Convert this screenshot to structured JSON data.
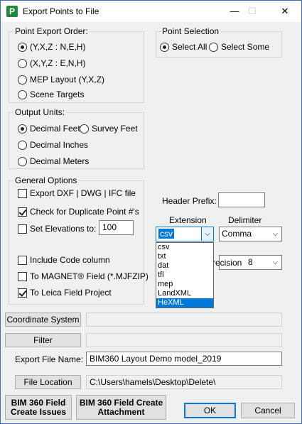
{
  "window": {
    "title": "Export Points to File",
    "icon_letter": "P",
    "minimize_glyph": "—",
    "maximize_glyph": "☐",
    "close_glyph": "✕"
  },
  "point_export_order": {
    "label": "Point Export Order:",
    "options": [
      "(Y,X,Z  :  N,E,H)",
      "(X,Y,Z  :  E,N,H)",
      "MEP Layout (Y,X,Z)",
      "Scene Targets"
    ],
    "selected_index": 0
  },
  "point_selection": {
    "label": "Point Selection",
    "options": [
      "Select All",
      "Select Some"
    ],
    "selected_index": 0
  },
  "output_units": {
    "label": "Output Units:",
    "options": [
      "Decimal Feet",
      "Survey Feet",
      "Decimal Inches",
      "Decimal Meters"
    ],
    "selected_index": 0
  },
  "general_options": {
    "label": "General Options",
    "export_dxf": {
      "label": "Export DXF | DWG | IFC file",
      "checked": false
    },
    "check_duplicates": {
      "label": "Check for Duplicate Point #'s",
      "checked": true
    },
    "set_elevations": {
      "label": "Set Elevations to:",
      "checked": false,
      "value": "100"
    },
    "include_code": {
      "label": "Include Code column",
      "checked": false
    },
    "to_magnet": {
      "label": "To MAGNET® Field (*.MJFZIP)",
      "checked": false
    },
    "to_leica": {
      "label": "To Leica Field Project",
      "checked": true
    }
  },
  "header_prefix": {
    "label": "Header Prefix:",
    "value": ""
  },
  "extension": {
    "label": "Extension",
    "value": "csv",
    "options": [
      "csv",
      "txt",
      "dat",
      "tfl",
      "mep",
      "LandXML",
      "HeXML"
    ],
    "highlighted_index": 6
  },
  "delimiter": {
    "label": "Delimiter",
    "value": "Comma"
  },
  "precision": {
    "label_visible": "recision",
    "value": "8"
  },
  "coordinate_system": {
    "button": "Coordinate System",
    "value": ""
  },
  "filter": {
    "button": "Filter",
    "value": ""
  },
  "export_file_name": {
    "label": "Export File Name:",
    "value": "BIM360 Layout Demo model_2019"
  },
  "file_location": {
    "button": "File Location",
    "value": "C:\\Users\\hamels\\Desktop\\Delete\\"
  },
  "bottom_buttons": {
    "create_issues_line1": "BIM 360 Field",
    "create_issues_line2": "Create Issues",
    "create_attachment_line1": "BIM 360 Field Create",
    "create_attachment_line2": "Attachment",
    "ok": "OK",
    "cancel": "Cancel"
  }
}
